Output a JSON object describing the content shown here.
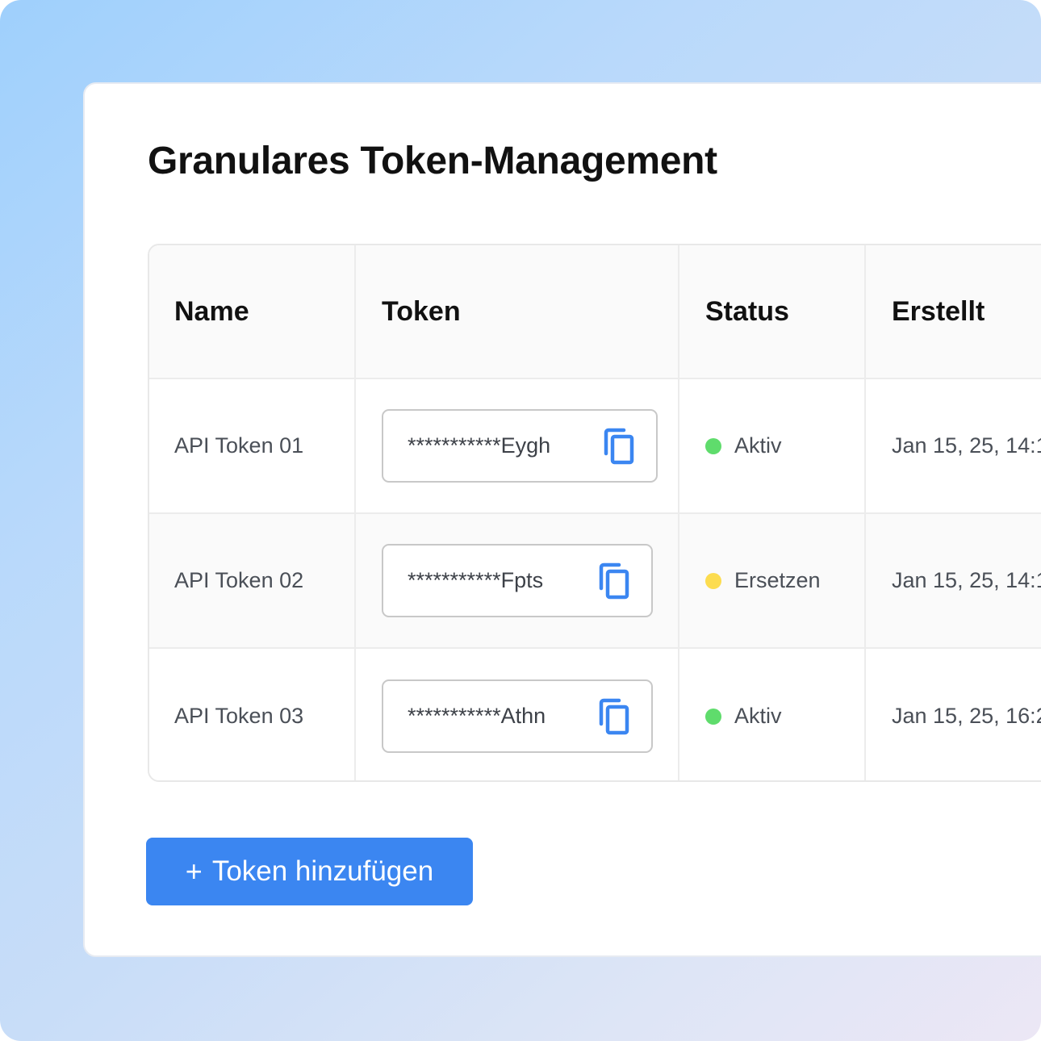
{
  "page": {
    "title": "Granulares Token-Management"
  },
  "table": {
    "columns": {
      "name": "Name",
      "token": "Token",
      "status": "Status",
      "created": "Erstellt"
    },
    "rows": [
      {
        "name": "API Token 01",
        "token": "***********Eygh",
        "status": "Aktiv",
        "status_color": "#5fdc6c",
        "created": "Jan 15, 25, 14:1"
      },
      {
        "name": "API Token 02",
        "token": "***********Fpts",
        "status": "Ersetzen",
        "status_color": "#fcdc4f",
        "created": "Jan 15, 25, 14:1"
      },
      {
        "name": "API Token 03",
        "token": "***********Athn",
        "status": "Aktiv",
        "status_color": "#5fdc6c",
        "created": "Jan 15, 25, 16:2"
      }
    ],
    "copy_icon": "copy-icon",
    "copy_icon_color": "#3b86f1"
  },
  "actions": {
    "add_plus": "+",
    "add_label": "Token hinzufügen",
    "add_color": "#3b86f1"
  }
}
